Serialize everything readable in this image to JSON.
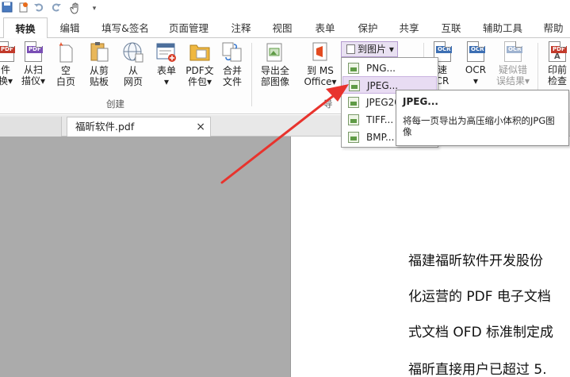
{
  "quick_access": {
    "icons": [
      "save-icon",
      "new-icon",
      "undo-icon",
      "redo-icon",
      "hand-icon",
      "dropdown-icon"
    ]
  },
  "tabs": [
    {
      "label": "转换",
      "active": true
    },
    {
      "label": "编辑"
    },
    {
      "label": "填写&签名"
    },
    {
      "label": "页面管理"
    },
    {
      "label": "注释"
    },
    {
      "label": "视图"
    },
    {
      "label": "表单"
    },
    {
      "label": "保护"
    },
    {
      "label": "共享"
    },
    {
      "label": "互联"
    },
    {
      "label": "辅助工具"
    },
    {
      "label": "帮助"
    }
  ],
  "ribbon": {
    "create_group": {
      "label": "创建",
      "buttons": [
        {
          "line1": "件",
          "line2": "换▾"
        },
        {
          "line1": "从扫",
          "line2": "描仪▾"
        },
        {
          "line1": "空",
          "line2": "白页"
        },
        {
          "line1": "从剪",
          "line2": "贴板"
        },
        {
          "line1": "从",
          "line2": "网页"
        },
        {
          "line1": "表单",
          "line2": "▾"
        },
        {
          "line1": "PDF文",
          "line2": "件包▾"
        },
        {
          "line1": "合并",
          "line2": "文件"
        }
      ]
    },
    "export_group": {
      "label": "导",
      "buttons": [
        {
          "line1": "导出全",
          "line2": "部图像"
        },
        {
          "line1": "到 MS",
          "line2": "Office▾"
        }
      ],
      "to_image_label": "到图片 ▾"
    },
    "ocr_group": {
      "buttons": [
        {
          "line1": "速",
          "line2": "CR"
        },
        {
          "line1": "OCR",
          "line2": "▾"
        },
        {
          "line1": "疑似错",
          "line2": "误结果▾"
        }
      ]
    },
    "print_group": {
      "buttons": [
        {
          "line1": "印前",
          "line2": "检查"
        }
      ]
    }
  },
  "menu": {
    "items": [
      {
        "label": "PNG..."
      },
      {
        "label": "JPEG...",
        "highlighted": true
      },
      {
        "label": "JPEG20"
      },
      {
        "label": "TIFF..."
      },
      {
        "label": "BMP..."
      }
    ]
  },
  "tooltip": {
    "title": "JPEG...",
    "desc": "将每一页导出为高压缩小体积的JPG图像"
  },
  "document": {
    "tab_label": "福昕软件.pdf",
    "close_label": "×",
    "lines": [
      "福建福昕软件开发股份",
      "化运营的 PDF 电子文档",
      "式文档 OFD 标准制定成",
      "福昕直接用户已超过 5."
    ]
  },
  "colors": {
    "arrow": "#e8332d",
    "highlight": "#e8dcf3",
    "workspace": "#ababab"
  }
}
